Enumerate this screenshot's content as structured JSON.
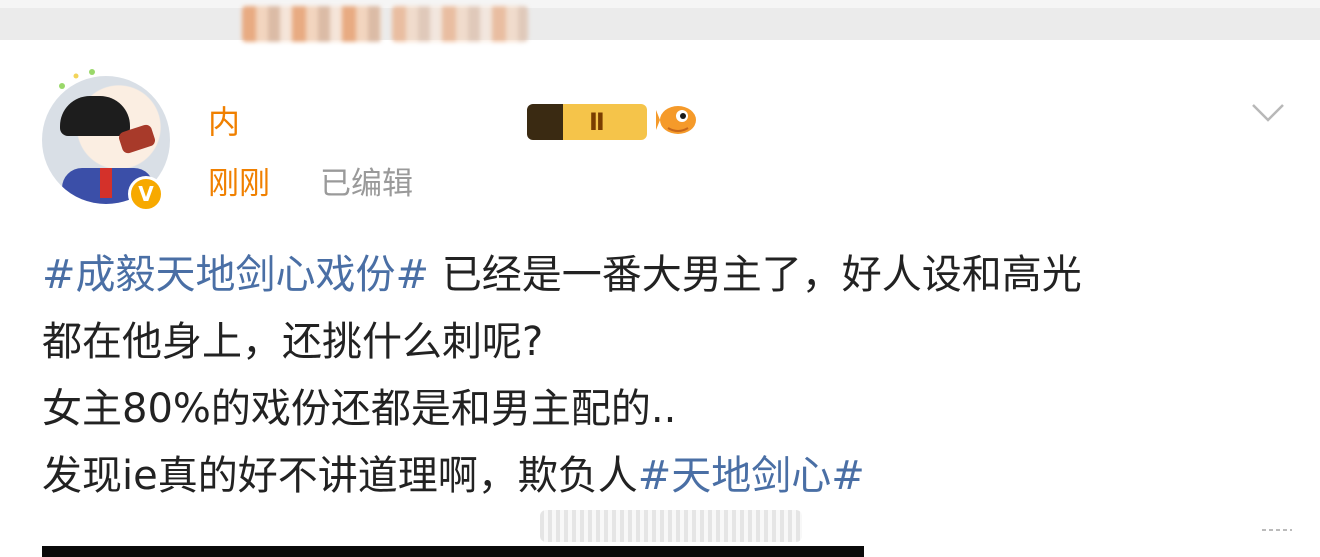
{
  "post": {
    "author": {
      "name_visible_prefix": "内",
      "vip_level_label": "Ⅱ"
    },
    "time": "刚刚",
    "edited": "已编辑",
    "content": {
      "line1": {
        "tag": "#成毅天地剑心戏份#",
        "text": " 已经是一番大男主了，好人设和高光"
      },
      "line2": "都在他身上，还挑什么刺呢?",
      "line3": "女主80%的戏份还都是和男主配的..",
      "line4": {
        "text": " 发现ie真的好不讲道理啊，欺负人",
        "tag": "#天地剑心#"
      }
    }
  },
  "icons": {
    "verified": "verified-v-badge-icon",
    "vip": "vip-level-badge-icon",
    "fish": "fish-emoji-icon",
    "more": "chevron-down-icon"
  },
  "colors": {
    "name": "#f08000",
    "time": "#f08000",
    "meta": "#9a9a9a",
    "topic_tag": "#4a6fa5",
    "text": "#222222"
  }
}
